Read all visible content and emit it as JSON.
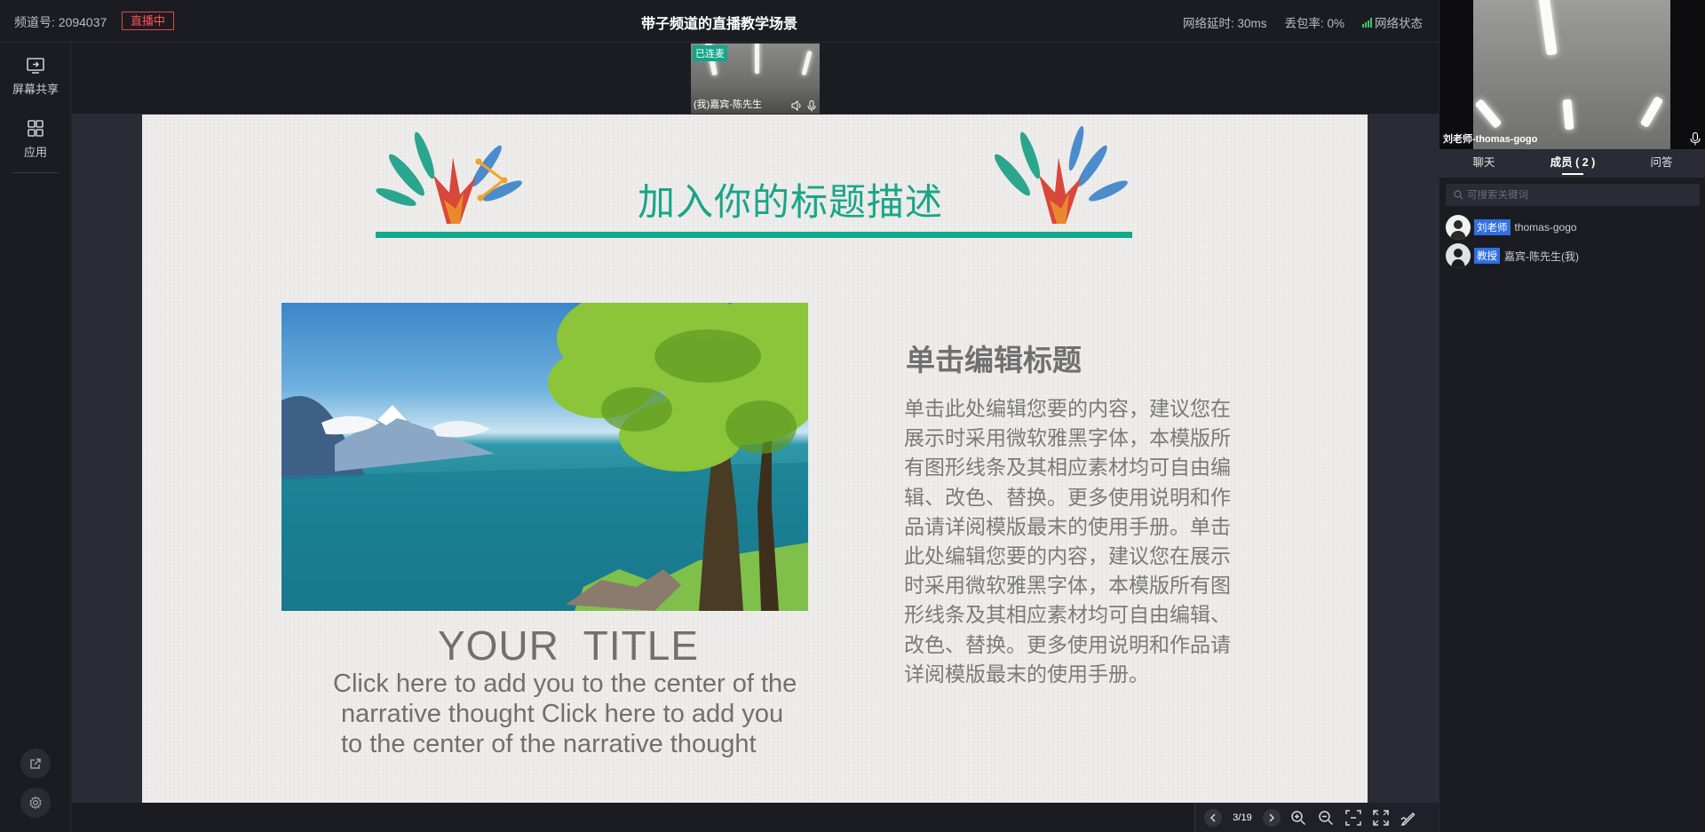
{
  "topbar": {
    "channel": "频道号: 2094037",
    "live_badge": "直播中",
    "room_title": "带子频道的直播教学场景",
    "latency": "网络延时: 30ms",
    "packet_loss": "丢包率: 0%",
    "network_status": "网络状态",
    "signal_color": "#3cc46a"
  },
  "leftbar": {
    "items": [
      {
        "label": "屏幕共享",
        "icon": "screen-share-icon"
      },
      {
        "label": "应用",
        "icon": "apps-grid-icon"
      }
    ],
    "bottom_icons": [
      "external-link-icon",
      "gear-icon"
    ]
  },
  "stage": {
    "camera_tile": {
      "tag": "已连麦",
      "name": "(我)嘉宾-陈先生",
      "icons": [
        "speaker-icon",
        "microphone-icon"
      ]
    }
  },
  "slide": {
    "heading": "加入你的标题描述",
    "accent_color": "#13a88c",
    "image_title": "YOUR  TITLE",
    "image_subtitle": [
      "Click here to add you to the center of the",
      "narrative thought Click here to add you",
      "to the center of the narrative thought"
    ],
    "edit_title": "单击编辑标题",
    "edit_body": "单击此处编辑您要的内容，建议您在展示时采用微软雅黑字体，本模版所有图形线条及其相应素材均可自由编辑、改色、替换。更多使用说明和作品请详阅模版最末的使用手册。单击此处编辑您要的内容，建议您在展示时采用微软雅黑字体，本模版所有图形线条及其相应素材均可自由编辑、改色、替换。更多使用说明和作品请详阅模版最末的使用手册。"
  },
  "toolbar": {
    "page_indicator": "3/19",
    "icons": [
      "chevron-left-icon",
      "chevron-right-icon",
      "zoom-in-icon",
      "zoom-out-icon",
      "fit-screen-icon",
      "fullscreen-icon",
      "annotate-icon"
    ]
  },
  "rightpanel": {
    "video_name": "刘老师-thomas-gogo",
    "tabs": [
      {
        "label": "聊天",
        "active": false
      },
      {
        "label": "成员 ( 2 )",
        "active": true
      },
      {
        "label": "问答",
        "active": false
      }
    ],
    "search_placeholder": "可搜索关键词",
    "members": [
      {
        "role": "刘老师",
        "name": "thomas-gogo"
      },
      {
        "role": "教授",
        "name": "嘉宾-陈先生(我)"
      }
    ],
    "role_color": "#2f6fe0"
  }
}
